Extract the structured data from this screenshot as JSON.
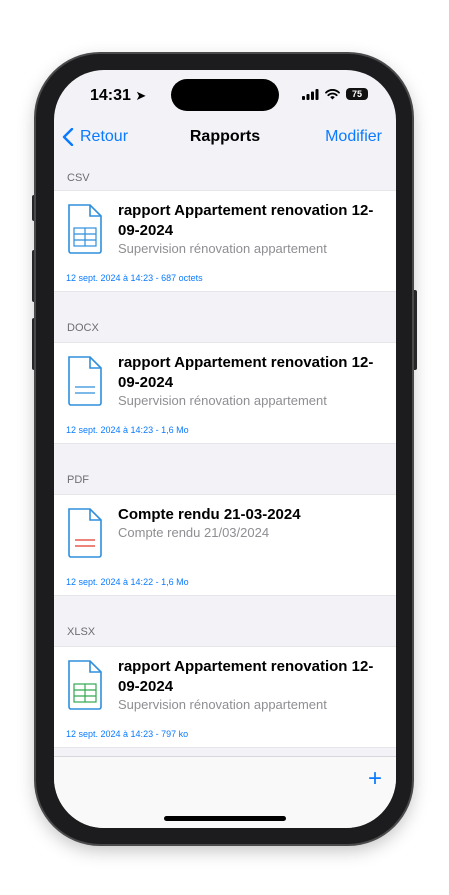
{
  "status": {
    "time": "14:31",
    "battery": "75"
  },
  "nav": {
    "back_label": "Retour",
    "title": "Rapports",
    "edit_label": "Modifier"
  },
  "sections": [
    {
      "header": "CSV",
      "icon": "csv-file-icon",
      "accent": "#2f8fdc",
      "title": "rapport Appartement renovation 12-09-2024",
      "subtitle": "Supervision rénovation appartement",
      "meta": "12 sept. 2024 à 14:23 - 687 octets"
    },
    {
      "header": "DOCX",
      "icon": "docx-file-icon",
      "accent": "#2f8fdc",
      "title": "rapport Appartement renovation 12-09-2024",
      "subtitle": "Supervision rénovation appartement",
      "meta": "12 sept. 2024 à 14:23 - 1,6 Mo"
    },
    {
      "header": "PDF",
      "icon": "pdf-file-icon",
      "accent": "#e03b2f",
      "title": "Compte rendu 21-03-2024",
      "subtitle": "Compte rendu 21/03/2024",
      "meta": "12 sept. 2024 à 14:22 - 1,6 Mo"
    },
    {
      "header": "XLSX",
      "icon": "xlsx-file-icon",
      "accent": "#34a853",
      "title": "rapport Appartement renovation 12-09-2024",
      "subtitle": "Supervision rénovation appartement",
      "meta": "12 sept. 2024 à 14:23 - 797 ko"
    }
  ],
  "toolbar": {
    "add_label": "+"
  },
  "colors": {
    "accent": "#0a7aff",
    "background": "#f2f2f7"
  }
}
